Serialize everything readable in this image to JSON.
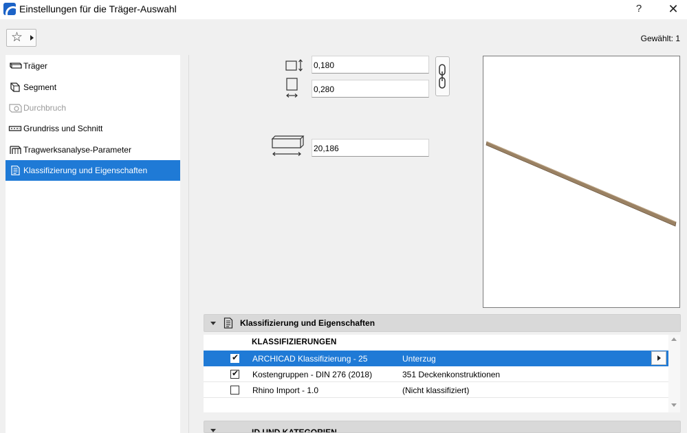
{
  "window": {
    "title": "Einstellungen für die Träger-Auswahl",
    "help_label": "?",
    "close_label": "✕"
  },
  "toolbar": {
    "favorites_icon": "star-icon",
    "selected_count": "Gewählt: 1"
  },
  "sidebar": {
    "items": [
      {
        "label": "Träger",
        "icon": "beam-icon"
      },
      {
        "label": "Segment",
        "icon": "segment-icon"
      },
      {
        "label": "Durchbruch",
        "icon": "opening-icon"
      },
      {
        "label": "Grundriss und Schnitt",
        "icon": "floor-plan-icon"
      },
      {
        "label": "Tragwerksanalyse-Parameter",
        "icon": "structural-analysis-icon"
      },
      {
        "label": "Klassifizierung und Eigenschaften",
        "icon": "classification-icon"
      }
    ],
    "active_index": 5,
    "disabled_index": 2
  },
  "parameters": {
    "width": "0,180",
    "height": "0,280",
    "length": "20,186"
  },
  "classification_panel": {
    "title": "Klassifizierung und Eigenschaften",
    "heading": "KLASSIFIZIERUNGEN",
    "rows": [
      {
        "name": "ARCHICAD Klassifizierung - 25",
        "value": "Unterzug",
        "checked": true
      },
      {
        "name": "Kostengruppen - DIN 276 (2018)",
        "value": "351 Deckenkonstruktionen",
        "checked": true
      },
      {
        "name": "Rhino Import - 1.0",
        "value": "(Nicht klassifiziert)",
        "checked": false
      }
    ]
  },
  "second_panel": {
    "title": "ID UND KATEGORIEN"
  },
  "colors": {
    "selection": "#1f7ad6",
    "beam": "#8a7358"
  }
}
